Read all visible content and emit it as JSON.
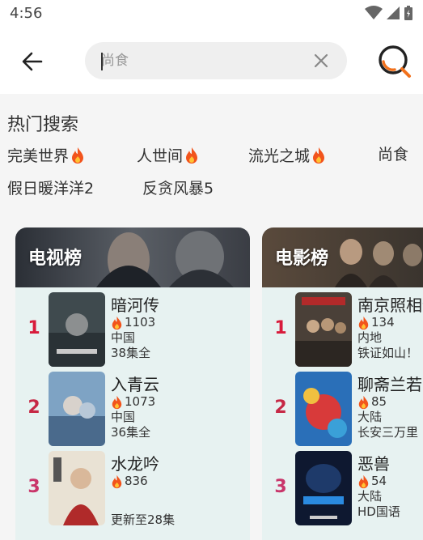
{
  "status": {
    "time": "4:56"
  },
  "search": {
    "placeholder": "尚食"
  },
  "hot": {
    "title": "热门搜索",
    "tags": [
      {
        "label": "完美世界",
        "hot": true
      },
      {
        "label": "人世间",
        "hot": true
      },
      {
        "label": "流光之城",
        "hot": true
      },
      {
        "label": "尚食",
        "hot": false
      },
      {
        "label": "假日暖洋洋2",
        "hot": false
      },
      {
        "label": "反贪风暴5",
        "hot": false
      }
    ]
  },
  "tv_ranking": {
    "title": "电视榜",
    "items": [
      {
        "rank": "1",
        "name": "暗河传",
        "heat": "1103",
        "region": "中国",
        "status": "38集全"
      },
      {
        "rank": "2",
        "name": "入青云",
        "heat": "1073",
        "region": "中国",
        "status": "36集全"
      },
      {
        "rank": "3",
        "name": "水龙吟",
        "heat": "836",
        "region": "",
        "status": "更新至28集"
      }
    ]
  },
  "movie_ranking": {
    "title": "电影榜",
    "items": [
      {
        "rank": "1",
        "name": "南京照相馆",
        "heat": "134",
        "region": "内地",
        "status": "铁证如山！"
      },
      {
        "rank": "2",
        "name": "聊斋兰若寺",
        "heat": "85",
        "region": "大陆",
        "status": "长安三万里"
      },
      {
        "rank": "3",
        "name": "恶兽",
        "heat": "54",
        "region": "大陆",
        "status": "HD国语"
      }
    ]
  },
  "colors": {
    "rank1": "#d81b3b",
    "rank2": "#c62845",
    "rank3": "#c9356a",
    "card_bg": "#e7f2f1",
    "search_orange": "#f2711c"
  }
}
